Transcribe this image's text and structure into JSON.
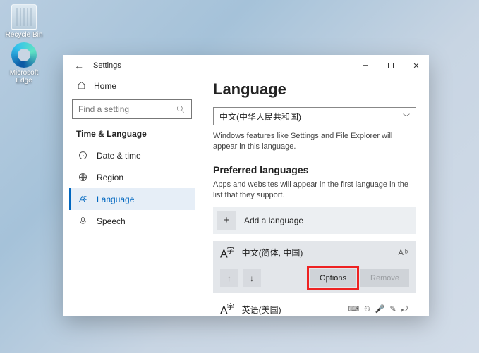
{
  "desktop": {
    "recycle_label": "Recycle Bin",
    "edge_label": "Microsoft Edge"
  },
  "window": {
    "title": "Settings"
  },
  "sidebar": {
    "home": "Home",
    "search_placeholder": "Find a setting",
    "category": "Time & Language",
    "items": [
      {
        "label": "Date & time"
      },
      {
        "label": "Region"
      },
      {
        "label": "Language"
      },
      {
        "label": "Speech"
      }
    ]
  },
  "main": {
    "heading": "Language",
    "dropdown_value": "中文(中华人民共和国)",
    "dropdown_caption": "Windows features like Settings and File Explorer will appear in this language.",
    "preferred_heading": "Preferred languages",
    "preferred_caption": "Apps and websites will appear in the first language in the list that they support.",
    "add_language": "Add a language",
    "lang1": {
      "name": "中文(简体, 中国)"
    },
    "lang2": {
      "name": "英语(美国)"
    },
    "options_btn": "Options",
    "remove_btn": "Remove"
  }
}
